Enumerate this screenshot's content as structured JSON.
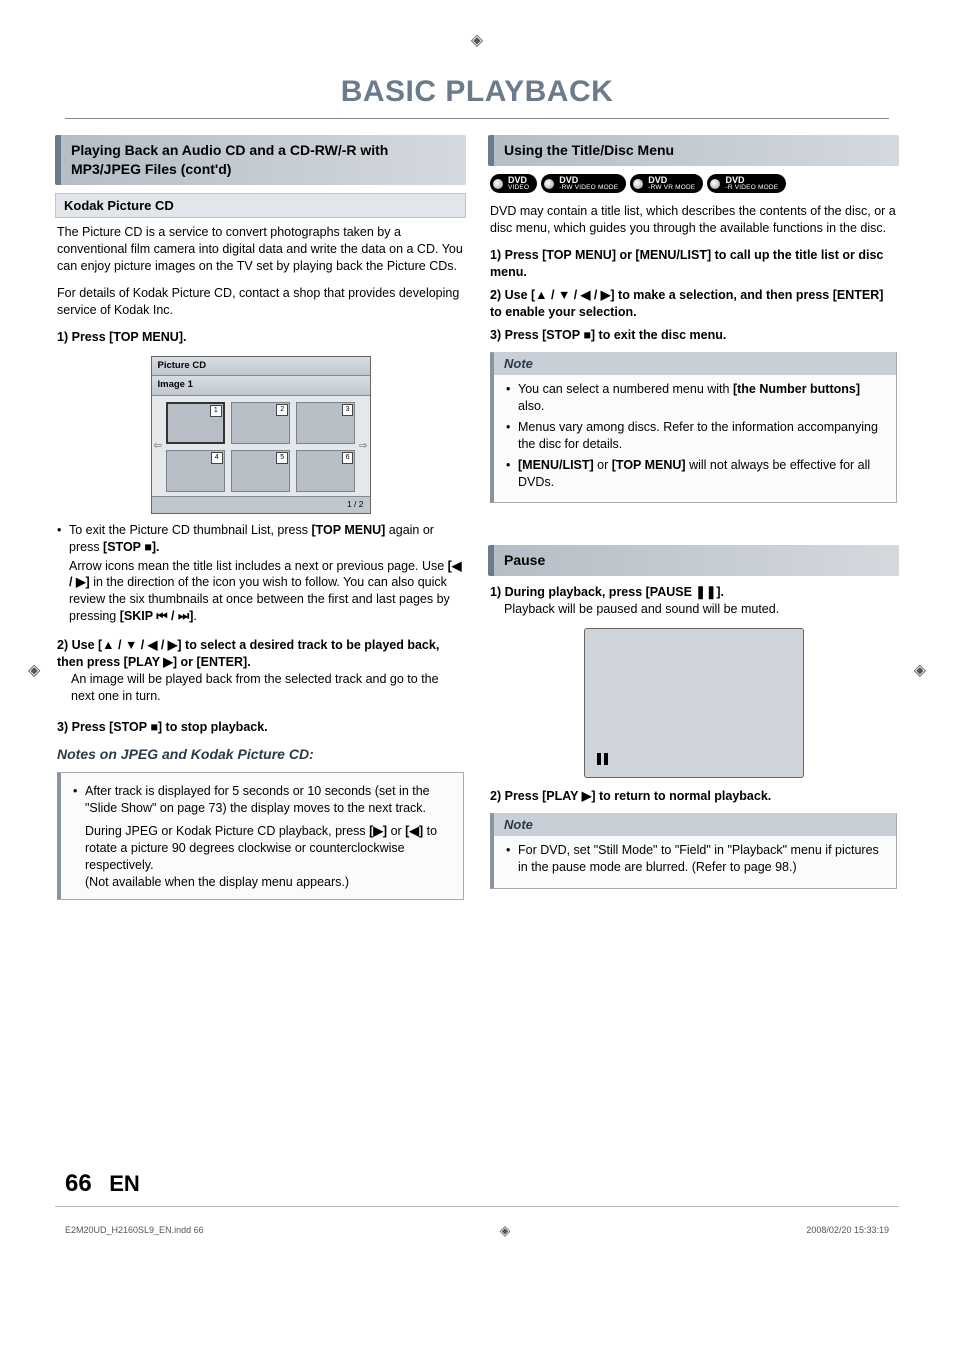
{
  "registration_glyph": "◈",
  "page_title": "BASIC PLAYBACK",
  "left": {
    "section1": "Playing Back an Audio CD and a CD-RW/-R with MP3/JPEG Files (cont'd)",
    "kodak_head": "Kodak Picture CD",
    "kodak_intro": "The Picture CD is a service to convert photographs taken by a conventional film camera into digital data and write the data on a CD. You can enjoy picture images on the TV set by playing back the Picture CDs.",
    "kodak_detail": "For details of Kodak Picture CD, contact a shop that provides developing service of Kodak Inc.",
    "step1": {
      "num": "1)",
      "text": "Press [TOP MENU]."
    },
    "thumb": {
      "title": "Picture CD",
      "subtitle": "Image 1",
      "cells": [
        "1",
        "2",
        "3",
        "4",
        "5",
        "6"
      ],
      "arrow_l": "⇦",
      "arrow_r": "⇨",
      "footer": "1 / 2"
    },
    "step1_bullet": {
      "line1_a": "To exit the Picture CD thumbnail List, press ",
      "line1_b": "[TOP MENU]",
      "line1_c": " again or press ",
      "line1_d": "[STOP ■].",
      "line2_a": "Arrow icons mean the title list includes a next or previous page. Use ",
      "line2_b": "[◀ / ▶]",
      "line2_c": " in the direction of the icon you wish to follow. You can also quick review the six thumbnails at once between the first and last pages by pressing ",
      "line2_d": "[SKIP ⏮ / ⏭]",
      "line2_e": "."
    },
    "step2": {
      "num": "2)",
      "bold_a": "Use [▲ / ▼ / ◀ / ▶] to select a desired track to be played back, then press [PLAY ▶] or [ENTER].",
      "sub": "An image will be played back from the selected track and go to the next one in turn."
    },
    "step3": {
      "num": "3)",
      "text": "Press [STOP ■] to stop playback."
    },
    "jpeg_title": "Notes on JPEG and Kodak Picture CD:",
    "jpeg_b1": "After track is displayed for 5 seconds or 10 seconds (set in the \"Slide Show\" on page 73) the display moves to the next track.",
    "jpeg_b2_a": "During JPEG or Kodak Picture CD playback, press ",
    "jpeg_b2_b": "[▶]",
    "jpeg_b2_c": " or ",
    "jpeg_b2_d": "[◀]",
    "jpeg_b2_e": " to rotate a picture 90 degrees clockwise or counterclockwise respectively.",
    "jpeg_b2_f": "(Not available when the display menu appears.)"
  },
  "right": {
    "section2": "Using the Title/Disc Menu",
    "badges": [
      {
        "main": "DVD",
        "sub": "VIDEO"
      },
      {
        "main": "DVD",
        "sub": "-RW VIDEO MODE"
      },
      {
        "main": "DVD",
        "sub": "-RW VR MODE"
      },
      {
        "main": "DVD",
        "sub": "-R VIDEO MODE"
      }
    ],
    "intro": "DVD may contain a title list, which describes the contents of the disc, or a disc menu, which guides you through the available functions in the disc.",
    "step1": {
      "num": "1)",
      "text": "Press [TOP MENU] or [MENU/LIST] to call up the title list or disc menu."
    },
    "step2": {
      "num": "2)",
      "text": "Use [▲ / ▼ / ◀ / ▶] to make a selection, and then press [ENTER] to enable your selection."
    },
    "step3": {
      "num": "3)",
      "text": "Press [STOP ■] to exit the disc menu."
    },
    "note_title": "Note",
    "note_b1_a": "You can select a numbered menu with ",
    "note_b1_b": "[the Number buttons]",
    "note_b1_c": " also.",
    "note_b2": "Menus vary among discs. Refer to the information accompanying the disc for details.",
    "note_b3_a": "[MENU/LIST]",
    "note_b3_b": " or ",
    "note_b3_c": "[TOP MENU]",
    "note_b3_d": " will not always be effective for all DVDs.",
    "section3": "Pause",
    "pause1": {
      "num": "1)",
      "bold": "During playback, press [PAUSE ❚❚].",
      "sub": "Playback will be paused and sound will be muted."
    },
    "pause2": {
      "num": "2)",
      "text": "Press [PLAY ▶] to return to normal playback."
    },
    "note2_b1": "For DVD, set \"Still Mode\" to \"Field\" in \"Playback\" menu if pictures in the pause mode are blurred. (Refer to page 98.)"
  },
  "footer": {
    "page_num": "66",
    "lang": "EN",
    "imprint_left": "E2M20UD_H2160SL9_EN.indd   66",
    "imprint_right": "2008/02/20   15:33:19"
  }
}
